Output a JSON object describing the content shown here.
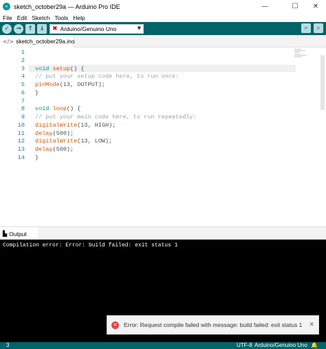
{
  "window": {
    "title": "sketch_october29a — Arduino Pro IDE",
    "logo_text": "∞",
    "controls": {
      "minimize": "—",
      "maximize": "☐",
      "close": "✕"
    }
  },
  "menu": {
    "items": [
      "File",
      "Edit",
      "Sketch",
      "Tools",
      "Help"
    ]
  },
  "toolbar": {
    "verify_icon": "✓",
    "upload_icon": "→",
    "new_icon": "↑",
    "open_icon": "↓",
    "board_status_icon": "✖",
    "board_label": "Arduino/Genuino Uno",
    "board_caret": "▼",
    "serial_plotter_icon": "⌕",
    "serial_monitor_icon": "⌕",
    "accent_color": "#006468"
  },
  "tabs": {
    "file_tab_icon": "</>",
    "file_tab_label": "sketch_october29a.ino"
  },
  "editor": {
    "line_numbers": [
      "1",
      "2",
      "3",
      "4",
      "5",
      "6",
      "7",
      "8",
      "9",
      "10",
      "11",
      "12",
      "13",
      "14"
    ],
    "lines": [
      [],
      [],
      [
        {
          "t": "void",
          "c": "kw"
        },
        {
          "t": " "
        },
        {
          "t": "setup",
          "c": "fn"
        },
        {
          "t": "() {"
        }
      ],
      [
        {
          "t": "// put your setup code here, to run once:",
          "c": "cm"
        }
      ],
      [
        {
          "t": "pinMode",
          "c": "fn"
        },
        {
          "t": "(13, OUTPUT);"
        }
      ],
      [
        {
          "t": "}"
        }
      ],
      [],
      [
        {
          "t": "void",
          "c": "kw"
        },
        {
          "t": " "
        },
        {
          "t": "loop",
          "c": "fn"
        },
        {
          "t": "() {"
        }
      ],
      [
        {
          "t": "// put your main code here, to run repeatedly:",
          "c": "cm"
        }
      ],
      [
        {
          "t": "digitalWrite",
          "c": "fn"
        },
        {
          "t": "(13, HIGH);"
        }
      ],
      [
        {
          "t": "delay",
          "c": "fn"
        },
        {
          "t": "(500);"
        }
      ],
      [
        {
          "t": "digitalWrite",
          "c": "fn"
        },
        {
          "t": "(13, LOW);"
        }
      ],
      [
        {
          "t": "delay",
          "c": "fn"
        },
        {
          "t": "(500);"
        }
      ],
      [
        {
          "t": "}"
        }
      ]
    ]
  },
  "output": {
    "tab_icon": "▙",
    "tab_label": "Output",
    "console_text": "Compilation error: Error: build failed: exit status 1"
  },
  "notification": {
    "icon": "✕",
    "message": "Error: Request compile failed with message: build failed: exit status 1",
    "close_icon": "✕"
  },
  "status": {
    "line": "3",
    "encoding": "UTF-8",
    "board": "Arduino/Genuino Uno",
    "bell_icon": "🔔"
  }
}
